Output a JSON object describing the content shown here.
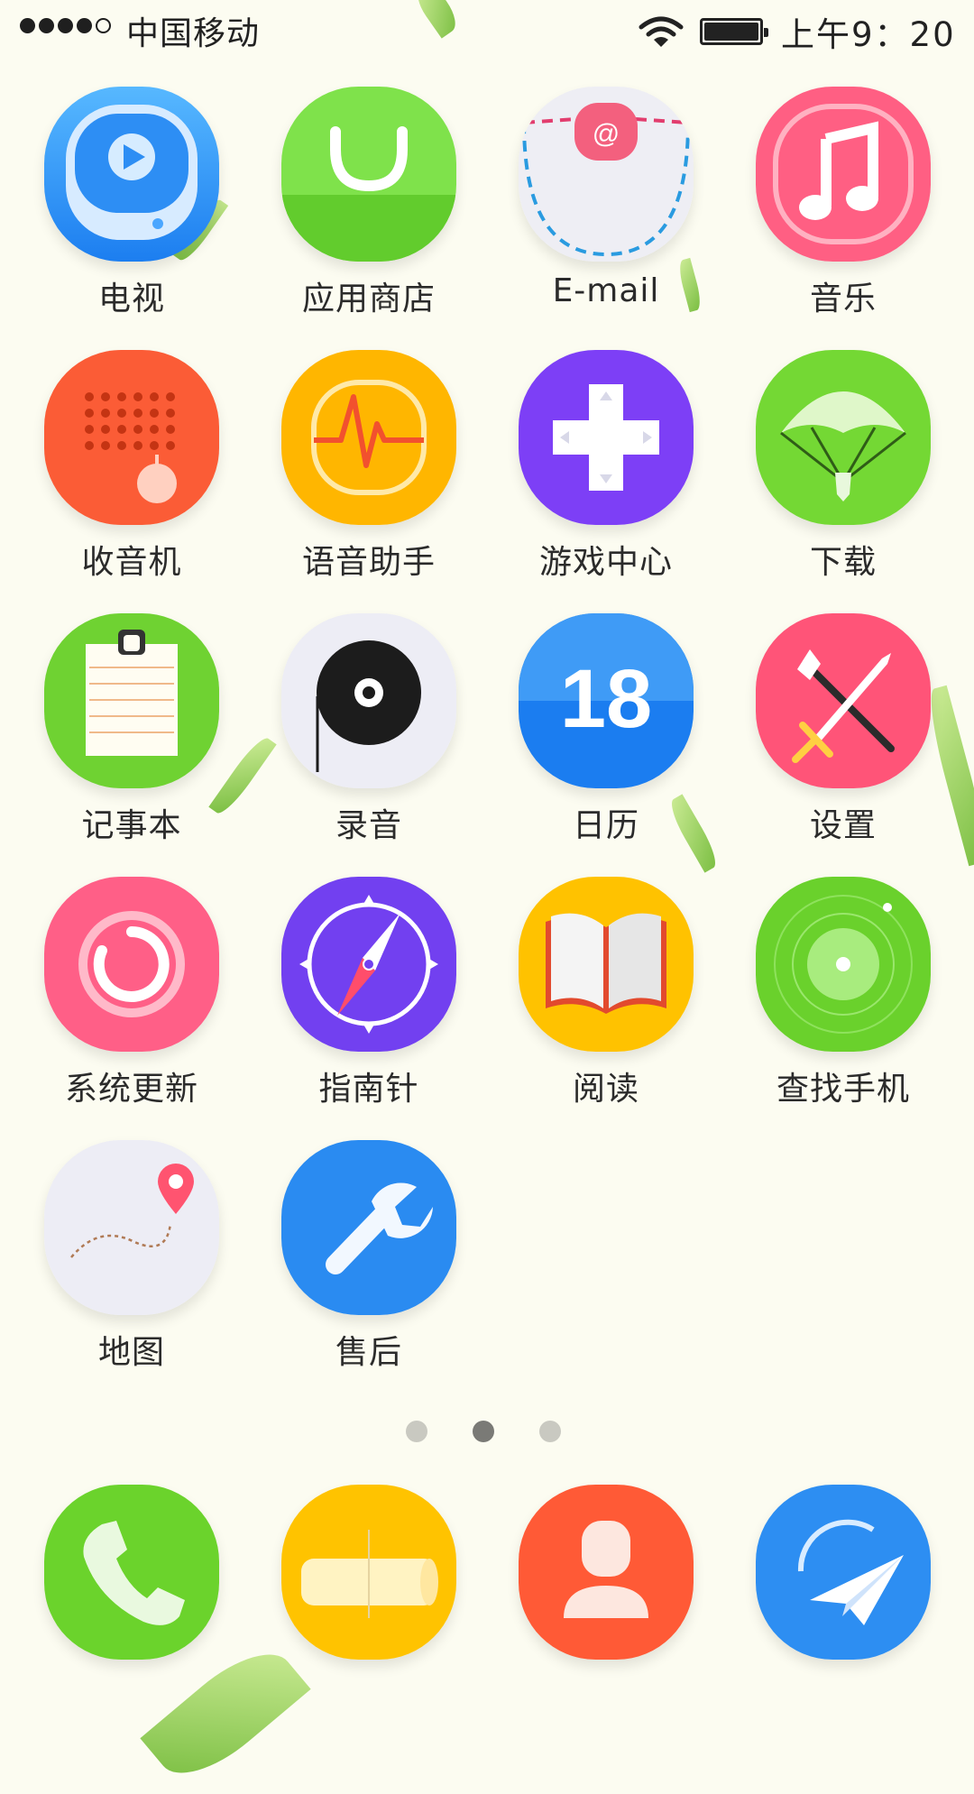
{
  "status_bar": {
    "carrier": "中国移动",
    "time": "上午9：20",
    "signal_bars_filled": 4,
    "signal_bars_total": 5
  },
  "apps": [
    {
      "label": "电视"
    },
    {
      "label": "应用商店"
    },
    {
      "label": "E-mail"
    },
    {
      "label": "音乐"
    },
    {
      "label": "收音机"
    },
    {
      "label": "语音助手"
    },
    {
      "label": "游戏中心"
    },
    {
      "label": "下载"
    },
    {
      "label": "记事本"
    },
    {
      "label": "录音"
    },
    {
      "label": "日历",
      "date": "18"
    },
    {
      "label": "设置"
    },
    {
      "label": "系统更新"
    },
    {
      "label": "指南针"
    },
    {
      "label": "阅读"
    },
    {
      "label": "查找手机"
    },
    {
      "label": "地图"
    },
    {
      "label": "售后"
    }
  ],
  "email_badge": "@",
  "page_indicator": {
    "count": 3,
    "active_index": 1
  },
  "dock": [
    "phone-icon",
    "scroll-icon",
    "contacts-icon",
    "paper-plane-icon"
  ]
}
